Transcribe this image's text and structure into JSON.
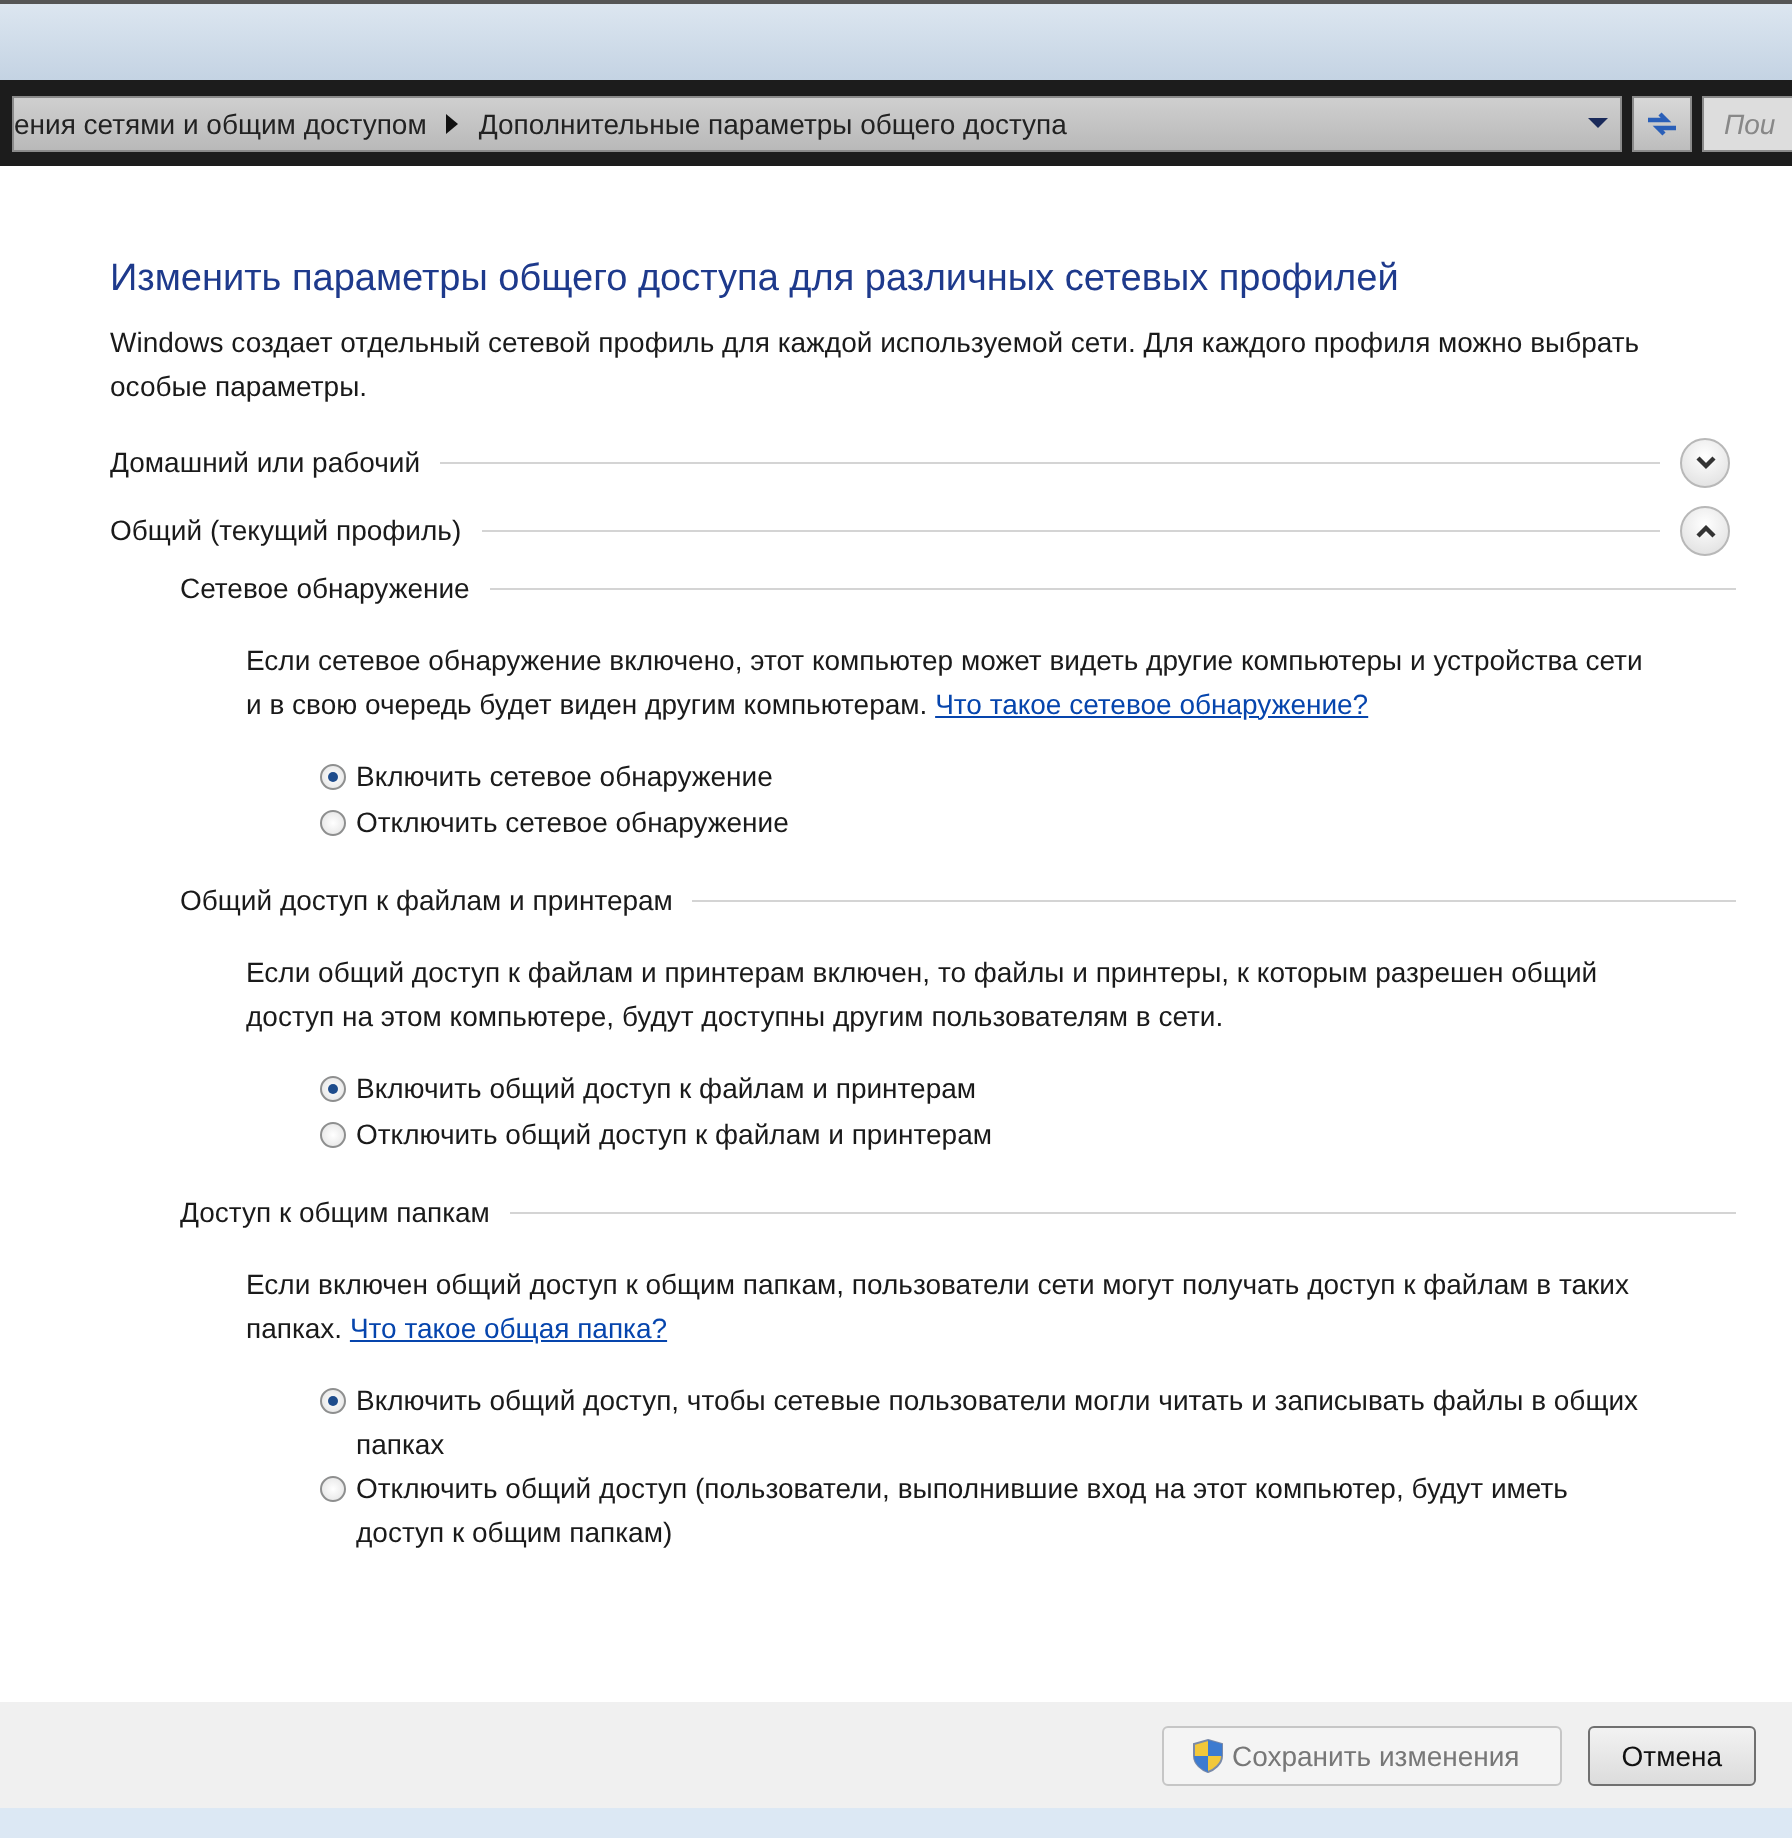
{
  "address_bar": {
    "breadcrumbs": [
      "ения сетями и общим доступом",
      "Дополнительные параметры общего доступа"
    ],
    "search_placeholder": "Пои"
  },
  "title": "Изменить параметры общего доступа для различных сетевых профилей",
  "description": "Windows создает отдельный сетевой профиль для каждой используемой сети. Для каждого профиля можно выбрать особые параметры.",
  "profiles": [
    {
      "name": "Домашний или рабочий",
      "expanded": false
    },
    {
      "name": "Общий (текущий профиль)",
      "expanded": true,
      "sections": [
        {
          "heading": "Сетевое обнаружение",
          "description": "Если сетевое обнаружение включено, этот компьютер может видеть другие компьютеры и устройства сети и в свою очередь будет виден другим компьютерам.",
          "link": "Что такое сетевое обнаружение?",
          "options": [
            {
              "label": "Включить сетевое обнаружение",
              "selected": true
            },
            {
              "label": "Отключить сетевое обнаружение",
              "selected": false
            }
          ]
        },
        {
          "heading": "Общий доступ к файлам и принтерам",
          "description": "Если общий доступ к файлам и принтерам включен, то файлы и принтеры, к которым разрешен общий доступ на этом компьютере, будут доступны другим пользователям в сети.",
          "options": [
            {
              "label": "Включить общий доступ к файлам и принтерам",
              "selected": true
            },
            {
              "label": "Отключить общий доступ к файлам и принтерам",
              "selected": false
            }
          ]
        },
        {
          "heading": "Доступ к общим папкам",
          "description": "Если включен общий доступ к общим папкам, пользователи сети могут получать доступ к файлам в таких папках.",
          "link": "Что такое общая папка?",
          "options": [
            {
              "label": "Включить общий доступ, чтобы сетевые пользователи могли читать и записывать файлы в общих папках",
              "selected": true
            },
            {
              "label": "Отключить общий доступ (пользователи, выполнившие вход на этот компьютер, будут иметь доступ к общим папкам)",
              "selected": false
            }
          ]
        }
      ]
    }
  ],
  "buttons": [
    {
      "label": "Сохранить изменения",
      "disabled": true,
      "kind": "shield"
    },
    {
      "label": "Отмена",
      "disabled": false,
      "kind": "plain"
    }
  ]
}
